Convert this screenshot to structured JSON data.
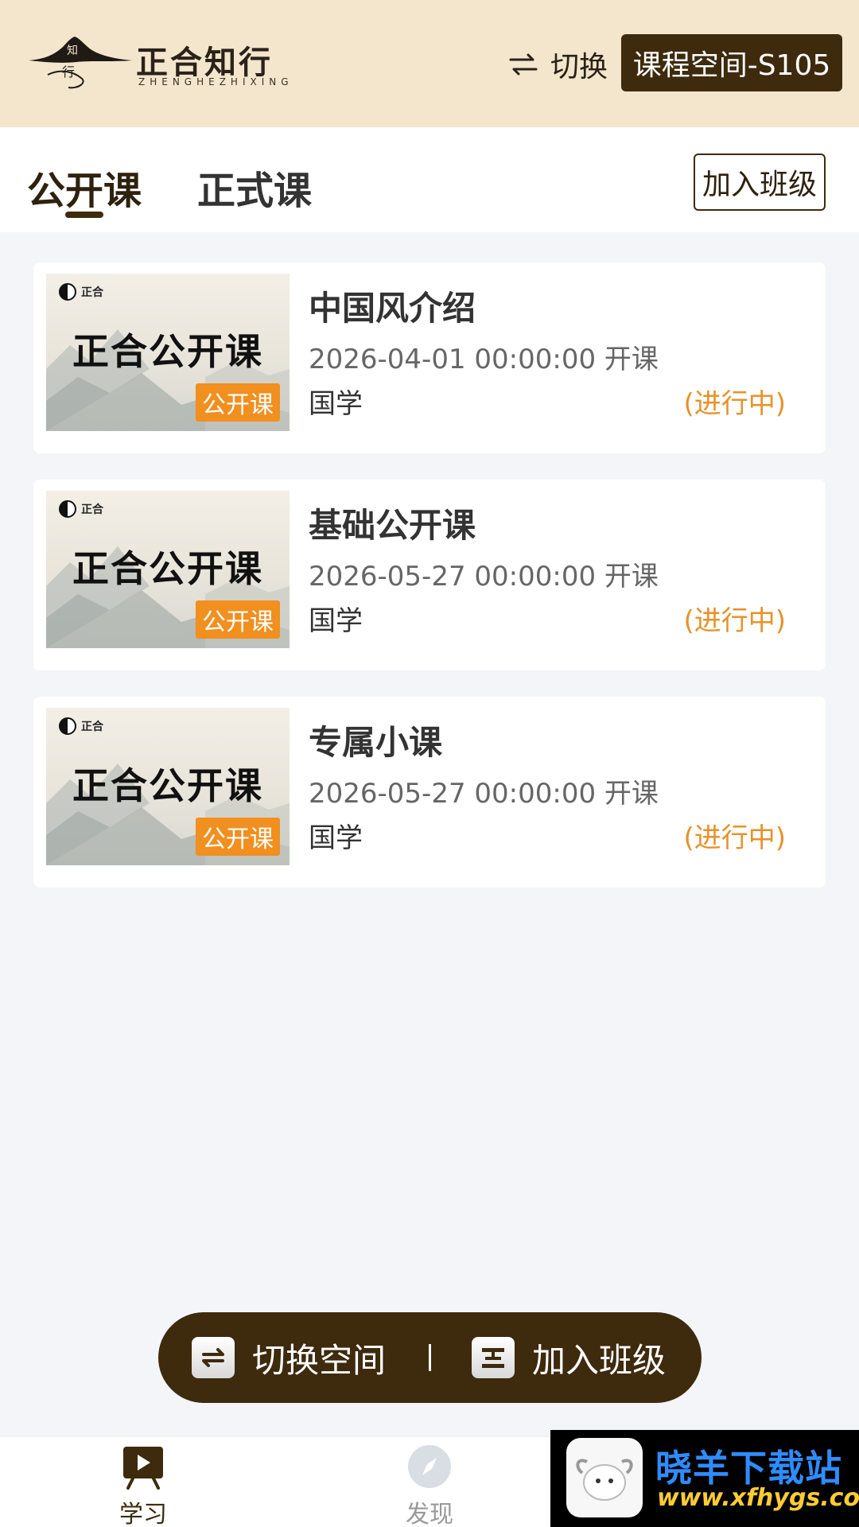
{
  "header": {
    "logo_title": "正合知行",
    "logo_subtitle": "ZHENGHEZHIXING",
    "logo_seal_top": "知",
    "logo_seal_bottom": "行",
    "switch_label": "切换",
    "space_name": "课程空间-S105"
  },
  "tabs": {
    "items": [
      {
        "label": "公开课",
        "active": true
      },
      {
        "label": "正式课",
        "active": false
      }
    ],
    "join_class_label": "加入班级"
  },
  "courses": [
    {
      "thumb_brand": "正合",
      "thumb_title": "正合公开课",
      "thumb_tag": "公开课",
      "name": "中国风介绍",
      "time": "2026-04-01 00:00:00 开课",
      "category": "国学",
      "status": "(进行中)"
    },
    {
      "thumb_brand": "正合",
      "thumb_title": "正合公开课",
      "thumb_tag": "公开课",
      "name": "基础公开课",
      "time": "2026-05-27 00:00:00 开课",
      "category": "国学",
      "status": "(进行中)"
    },
    {
      "thumb_brand": "正合",
      "thumb_title": "正合公开课",
      "thumb_tag": "公开课",
      "name": "专属小课",
      "time": "2026-05-27 00:00:00 开课",
      "category": "国学",
      "status": "(进行中)"
    }
  ],
  "floating_bar": {
    "switch_space_label": "切换空间",
    "join_class_label": "加入班级"
  },
  "bottom_nav": {
    "items": [
      {
        "label": "学习",
        "icon": "study-board-icon",
        "active": true
      },
      {
        "label": "发现",
        "icon": "compass-icon",
        "active": false
      }
    ]
  },
  "watermark": {
    "name": "晓羊下载站",
    "url": "www.xfhygs.com"
  },
  "colors": {
    "header_bg": "#f3e6cd",
    "brand_dark": "#3e2a0d",
    "status_orange": "#e7922a",
    "tag_orange": "#f18f1f",
    "page_bg": "#f4f5f9"
  }
}
